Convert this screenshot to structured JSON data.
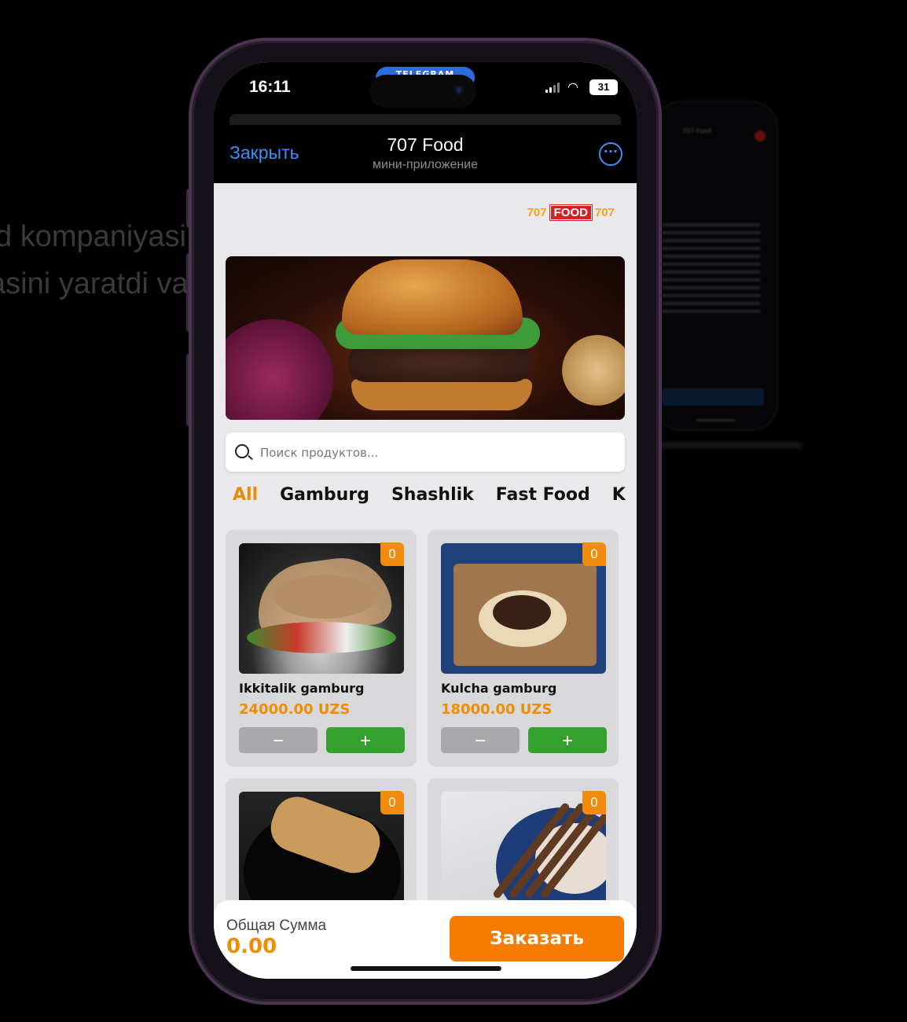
{
  "background": {
    "line1": "d kompaniyasi",
    "line2": "asini yaratdi va"
  },
  "statusbar": {
    "time": "16:11",
    "island_label": "TELEGRAM",
    "battery": "31"
  },
  "header": {
    "close_label": "Закрыть",
    "title": "707 Food",
    "subtitle": "мини-приложение"
  },
  "brand": {
    "left_num": "707",
    "word": "FOOD",
    "right_num": "707"
  },
  "search": {
    "placeholder": "Поиск продуктов..."
  },
  "categories": [
    {
      "label": "All",
      "active": true
    },
    {
      "label": "Gamburg",
      "active": false
    },
    {
      "label": "Shashlik",
      "active": false
    },
    {
      "label": "Fast Food",
      "active": false
    },
    {
      "label": "Kl",
      "active": false
    }
  ],
  "products": [
    {
      "name": "Ikkitalik gamburg",
      "price": "24000.00 UZS",
      "count": "0",
      "minus": "−",
      "plus": "+"
    },
    {
      "name": "Kulcha gamburg",
      "price": "18000.00 UZS",
      "count": "0",
      "minus": "−",
      "plus": "+"
    },
    {
      "name": "",
      "price": "",
      "count": "0"
    },
    {
      "name": "",
      "price": "",
      "count": "0"
    }
  ],
  "footer": {
    "total_label": "Общая Сумма",
    "total_value": "0.00",
    "order_label": "Заказать"
  },
  "colors": {
    "accent": "#f57c00",
    "price": "#f08c00",
    "plus": "#34a02d",
    "minus": "#a9a9ab",
    "link": "#3d8ef5"
  }
}
